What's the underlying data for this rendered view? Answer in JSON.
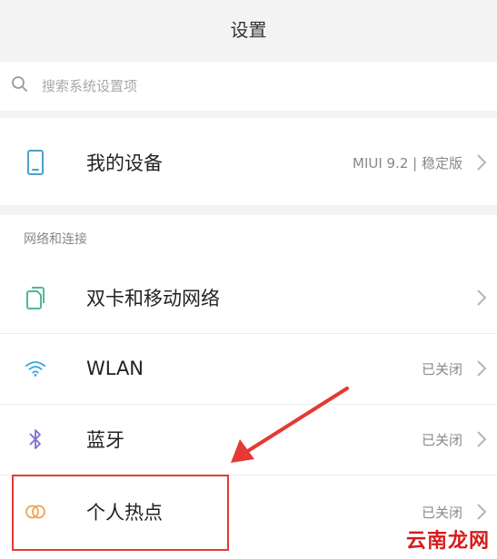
{
  "header": {
    "title": "设置"
  },
  "search": {
    "placeholder": "搜索系统设置项"
  },
  "my_device": {
    "label": "我的设备",
    "value": "MIUI 9.2 | 稳定版"
  },
  "network_section": {
    "header": "网络和连接",
    "items": [
      {
        "label": "双卡和移动网络",
        "value": ""
      },
      {
        "label": "WLAN",
        "value": "已关闭"
      },
      {
        "label": "蓝牙",
        "value": "已关闭"
      },
      {
        "label": "个人热点",
        "value": "已关闭"
      }
    ]
  },
  "watermark": {
    "text": "云南龙网"
  },
  "colors": {
    "device_icon": "#4aa3c8",
    "sim_icon": "#4fb892",
    "wlan_icon": "#3fa8d8",
    "bluetooth_icon": "#7b6fd0",
    "hotspot_icon": "#f0a04b",
    "annotation": "#e53935"
  }
}
